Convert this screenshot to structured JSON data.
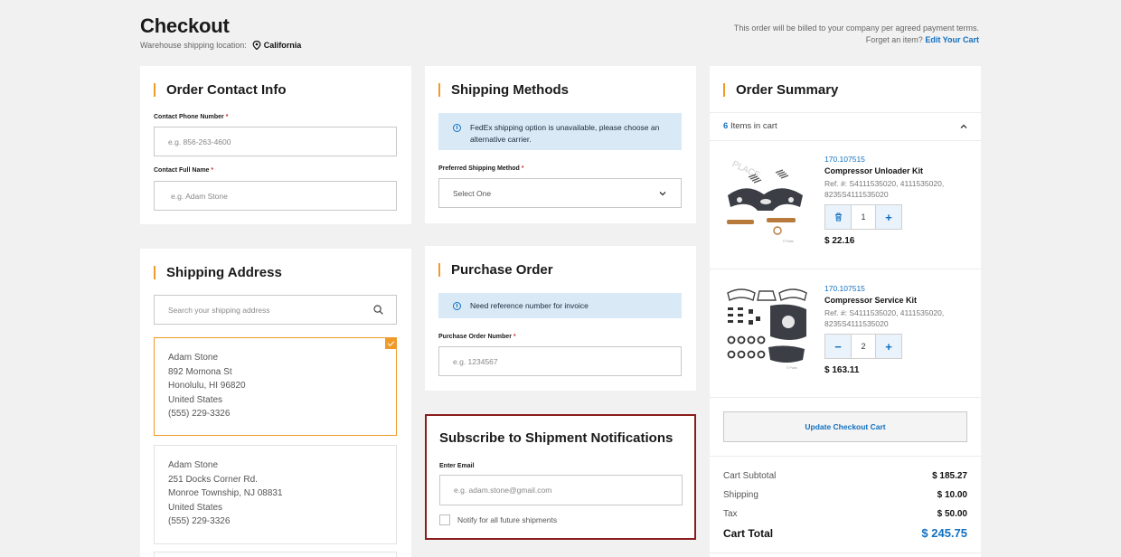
{
  "header": {
    "title": "Checkout",
    "location_label": "Warehouse shipping location:",
    "location_icon": "location-pin-icon",
    "location_value": "California",
    "billing_note": "This order will be billed to your company per agreed payment terms.",
    "forget_text": "Forget an item?",
    "edit_cart_link": "Edit Your Cart"
  },
  "contact": {
    "title": "Order Contact Info",
    "phone_label": "Contact Phone Number",
    "phone_placeholder": "e.g. 856-263-4600",
    "name_label": "Contact Full Name",
    "name_placeholder": "e.g. Adam Stone",
    "required_mark": "*"
  },
  "shipping_address": {
    "title": "Shipping Address",
    "search_placeholder": "Search your shipping address",
    "addresses": [
      {
        "name": "Adam Stone",
        "street": "892 Momona St",
        "city": "Honolulu, HI 96820",
        "country": "United States",
        "phone": "(555) 229-3326",
        "selected": true
      },
      {
        "name": "Adam Stone",
        "street": "251 Docks Corner Rd.",
        "city": "Monroe Township, NJ 08831",
        "country": "United States",
        "phone": "(555) 229-3326",
        "selected": false
      }
    ]
  },
  "shipping_methods": {
    "title": "Shipping Methods",
    "info": "FedEx shipping option is unavailable, please choose an alternative carrier.",
    "method_label": "Preferred Shipping Method",
    "select_value": "Select One"
  },
  "purchase_order": {
    "title": "Purchase Order",
    "info": "Need reference number for invoice",
    "po_label": "Purchase Order Number",
    "po_placeholder": "e.g. 1234567"
  },
  "notifications": {
    "title": "Subscribe to Shipment Notifications",
    "email_label": "Enter Email",
    "email_placeholder": "e.g. adam.stone@gmail.com",
    "checkbox_label": "Notify for all future shipments",
    "checkbox_checked": false,
    "highlight_color": "#8b1c1c"
  },
  "summary": {
    "title": "Order Summary",
    "items_count": "6",
    "items_text": "Items in cart",
    "items": [
      {
        "sku": "170.107515",
        "name": "Compressor Unloader Kit",
        "ref": "Ref. #: S4111535020, 4111535020, 8235S4111535020",
        "qty": "1",
        "price": "$ 22.16",
        "left_icon": "trash-icon"
      },
      {
        "sku": "170.107515",
        "name": "Compressor Service Kit",
        "ref": "Ref. #: S4111535020, 4111535020, 8235S4111535020",
        "qty": "2",
        "price": "$ 163.11",
        "left_icon": "minus-icon"
      }
    ],
    "update_button": "Update Checkout Cart",
    "subtotal_label": "Cart Subtotal",
    "subtotal": "$ 185.27",
    "shipping_label": "Shipping",
    "shipping": "$ 10.00",
    "tax_label": "Tax",
    "tax": "$ 50.00",
    "total_label": "Cart Total",
    "total": "$ 245.75"
  },
  "colors": {
    "accent_orange": "#f09a2a",
    "link_blue": "#1170c0",
    "info_bg": "#d9e9f6"
  }
}
